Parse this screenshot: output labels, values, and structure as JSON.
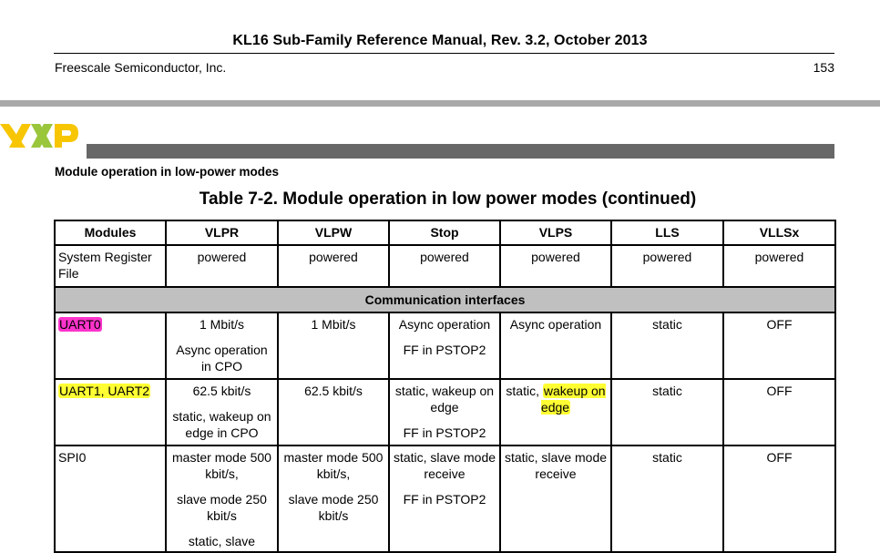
{
  "header": {
    "doc_title": "KL16 Sub-Family Reference Manual, Rev. 3.2, October 2013",
    "company": "Freescale Semiconductor, Inc.",
    "page_number": "153"
  },
  "section_heading": "Module operation in low-power modes",
  "table": {
    "caption": "Table 7-2.   Module operation in low power modes (continued)",
    "headers": [
      "Modules",
      "VLPR",
      "VLPW",
      "Stop",
      "VLPS",
      "LLS",
      "VLLSx"
    ],
    "row_sysreg": {
      "module": "System Register File",
      "vlpr": "powered",
      "vlpw": "powered",
      "stop": "powered",
      "vlps": "powered",
      "lls": "powered",
      "vllsx": "powered"
    },
    "section_label": "Communication interfaces",
    "row_uart0": {
      "module": "UART0",
      "vlpr_1": "1 Mbit/s",
      "vlpr_2": "Async operation in CPO",
      "vlpw": "1 Mbit/s",
      "stop_1": "Async operation",
      "stop_2": "FF in PSTOP2",
      "vlps": "Async operation",
      "lls": "static",
      "vllsx": "OFF"
    },
    "row_uart12": {
      "module": "UART1, UART2",
      "vlpr_1": "62.5 kbit/s",
      "vlpr_2": "static, wakeup on edge in CPO",
      "vlpw": "62.5 kbit/s",
      "stop_1": "static, wakeup on edge",
      "stop_2": "FF in PSTOP2",
      "vlps_plain": "static, ",
      "vlps_highlight": "wakeup on edge",
      "lls": "static",
      "vllsx": "OFF"
    },
    "row_spi0": {
      "module": "SPI0",
      "vlpr_1": "master mode 500 kbit/s,",
      "vlpr_2": "slave mode 250 kbit/s",
      "vlpr_3": "static, slave",
      "vlpw_1": "master mode 500 kbit/s,",
      "vlpw_2": "slave mode 250 kbit/s",
      "stop_1": "static, slave mode receive",
      "stop_2": "FF in PSTOP2",
      "vlps": "static, slave mode receive",
      "lls": "static",
      "vllsx": "OFF"
    }
  },
  "colors": {
    "highlight_magenta": "#ff33cc",
    "highlight_yellow": "#ffff33",
    "section_row_bg": "#c0c0c0",
    "logo_yellow": "#f7c600",
    "logo_white_on": "#ffffff"
  },
  "logo": {
    "name": "NXP-logo"
  }
}
